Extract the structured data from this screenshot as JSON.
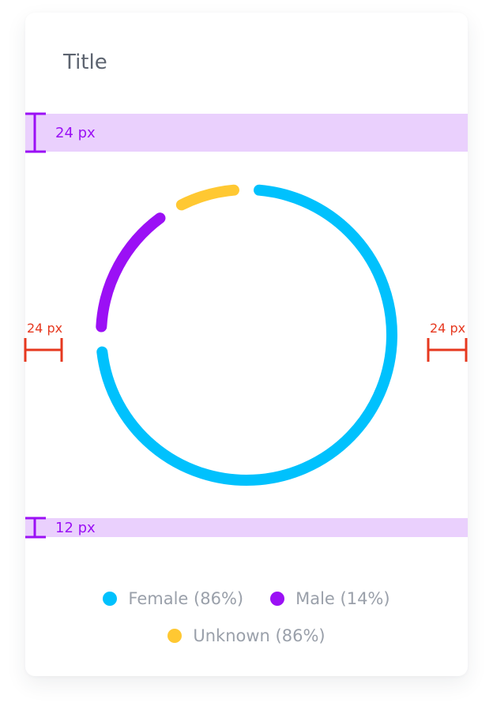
{
  "card": {
    "title": "Title"
  },
  "annotations": {
    "top_spacing": "24 px",
    "bottom_spacing": "12 px",
    "left_padding": "24 px",
    "right_padding": "24 px"
  },
  "colors": {
    "female": "#00c1fd",
    "male": "#9b10f5",
    "unknown": "#ffc832",
    "spacing_band": "#ead0fd",
    "annotation_purple": "#9b10f5",
    "annotation_red": "#e6381f"
  },
  "chart_data": {
    "type": "pie",
    "style": "donut-ring",
    "categories": [
      "Female",
      "Male",
      "Unknown"
    ],
    "values": [
      86,
      14,
      86
    ],
    "series": [
      {
        "name": "Female (86%)",
        "value": 86,
        "color": "#00c1fd"
      },
      {
        "name": "Male (14%)",
        "value": 14,
        "color": "#9b10f5"
      },
      {
        "name": "Unknown (86%)",
        "value": 86,
        "color": "#ffc832"
      }
    ]
  },
  "legend": {
    "items": [
      {
        "label": "Female (86%)",
        "color": "#00c1fd"
      },
      {
        "label": "Male (14%)",
        "color": "#9b10f5"
      },
      {
        "label": "Unknown (86%)",
        "color": "#ffc832"
      }
    ]
  }
}
